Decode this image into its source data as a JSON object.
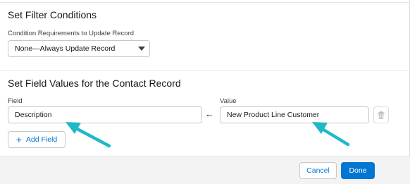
{
  "filter": {
    "heading": "Set Filter Conditions",
    "requirement_label": "Condition Requirements to Update Record",
    "requirement_value": "None—Always Update Record"
  },
  "field_values": {
    "heading": "Set Field Values for the Contact Record",
    "field_label": "Field",
    "field_value": "Description",
    "value_label": "Value",
    "value_value": "New Product Line Customer",
    "arrow_glyph": "←",
    "add_field_label": "Add Field"
  },
  "footer": {
    "cancel_label": "Cancel",
    "done_label": "Done"
  },
  "colors": {
    "brand": "#0176d3",
    "annotation_arrow": "#1fb8c9"
  }
}
